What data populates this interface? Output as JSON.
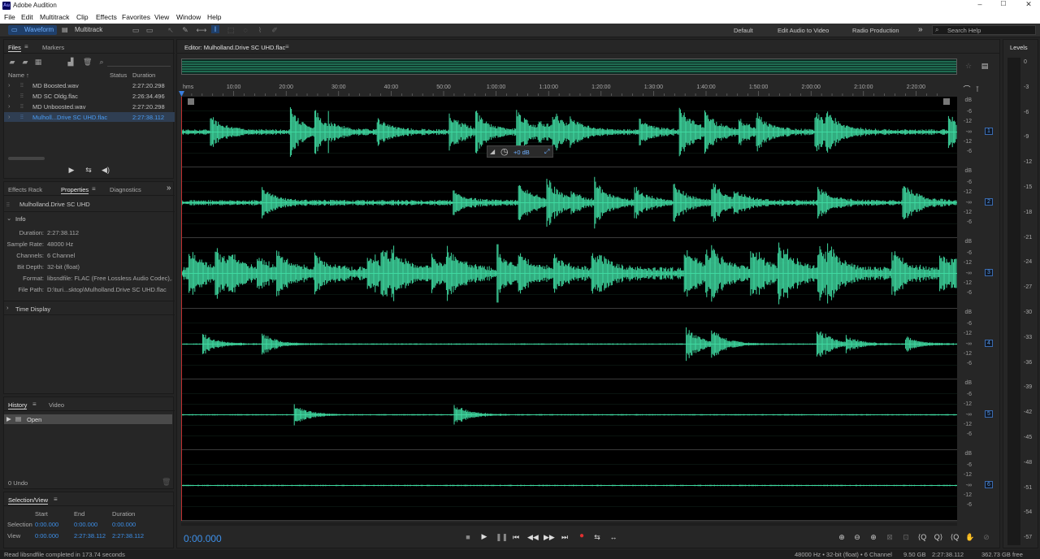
{
  "app": {
    "title": "Adobe Audition",
    "logo": "Au"
  },
  "menu": [
    "File",
    "Edit",
    "Multitrack",
    "Clip",
    "Effects",
    "Favorites",
    "View",
    "Window",
    "Help"
  ],
  "toolbar": {
    "waveform_label": "Waveform",
    "multitrack_label": "Multitrack",
    "workspaces": [
      "Default",
      "Edit Audio to Video",
      "Radio Production"
    ],
    "search_placeholder": "Search Help"
  },
  "files_panel": {
    "tabs": [
      "Files",
      "Markers"
    ],
    "columns": {
      "name": "Name",
      "status": "Status",
      "duration": "Duration"
    },
    "files": [
      {
        "name": "MD Boosted.wav",
        "duration": "2:27:20.298",
        "selected": false
      },
      {
        "name": "MD SC Oldg.flac",
        "duration": "2:26:34.496",
        "selected": false
      },
      {
        "name": "MD Unboosted.wav",
        "duration": "2:27:20.298",
        "selected": false
      },
      {
        "name": "Mulholl...Drive SC UHD.flac",
        "duration": "2:27:38.112",
        "selected": true
      }
    ]
  },
  "properties_panel": {
    "tabs": [
      "Effects Rack",
      "Properties",
      "Diagnostics"
    ],
    "file_title": "Mulholland.Drive SC UHD",
    "info_header": "Info",
    "info": [
      {
        "label": "Duration:",
        "value": "2:27:38.112"
      },
      {
        "label": "Sample Rate:",
        "value": "48000 Hz"
      },
      {
        "label": "Channels:",
        "value": "6 Channel"
      },
      {
        "label": "Bit Depth:",
        "value": "32-bit (float)"
      },
      {
        "label": "Format:",
        "value": "libsndfile: FLAC (Free Lossless Audio Codec),..."
      },
      {
        "label": "File Path:",
        "value": "D:\\turi...sktop\\Mulholland.Drive SC UHD.flac"
      }
    ],
    "time_display_header": "Time Display"
  },
  "history_panel": {
    "tabs": [
      "History",
      "Video"
    ],
    "items": [
      "Open"
    ],
    "undo_count": "0 Undo"
  },
  "selection_panel": {
    "title": "Selection/View",
    "columns": [
      "Start",
      "End",
      "Duration"
    ],
    "rows": [
      {
        "label": "Selection",
        "start": "0:00.000",
        "end": "0:00.000",
        "duration": "0:00.000"
      },
      {
        "label": "View",
        "start": "0:00.000",
        "end": "2:27:38.112",
        "duration": "2:27:38.112"
      }
    ]
  },
  "editor": {
    "title": "Editor: Mulholland.Drive SC UHD.flac",
    "ruler_unit": "hms",
    "ruler_ticks": [
      "10:00",
      "20:00",
      "30:00",
      "40:00",
      "50:00",
      "1:00:00",
      "1:10:00",
      "1:20:00",
      "1:30:00",
      "1:40:00",
      "1:50:00",
      "2:00:00",
      "2:10:00",
      "2:20:00"
    ],
    "db_labels": [
      "dB",
      "-6",
      "-12",
      "-∞",
      "-12",
      "-6"
    ],
    "channels": [
      "1",
      "2",
      "3",
      "4",
      "5",
      "6"
    ],
    "hud_value": "+0 dB",
    "current_time": "0:00.000",
    "waveform_color": "#3fd9a0"
  },
  "levels": {
    "title": "Levels",
    "scale": [
      "0",
      "-3",
      "-6",
      "-9",
      "-12",
      "-15",
      "-18",
      "-21",
      "-24",
      "-27",
      "-30",
      "-33",
      "-36",
      "-39",
      "-42",
      "-45",
      "-48",
      "-51",
      "-54",
      "-57"
    ]
  },
  "statusbar": {
    "message": "Read libsndfile completed in 173.74 seconds",
    "format": "48000 Hz • 32-bit (float) • 6 Channel",
    "size": "9.50 GB",
    "duration": "2:27:38.112",
    "free": "362.73 GB free"
  }
}
